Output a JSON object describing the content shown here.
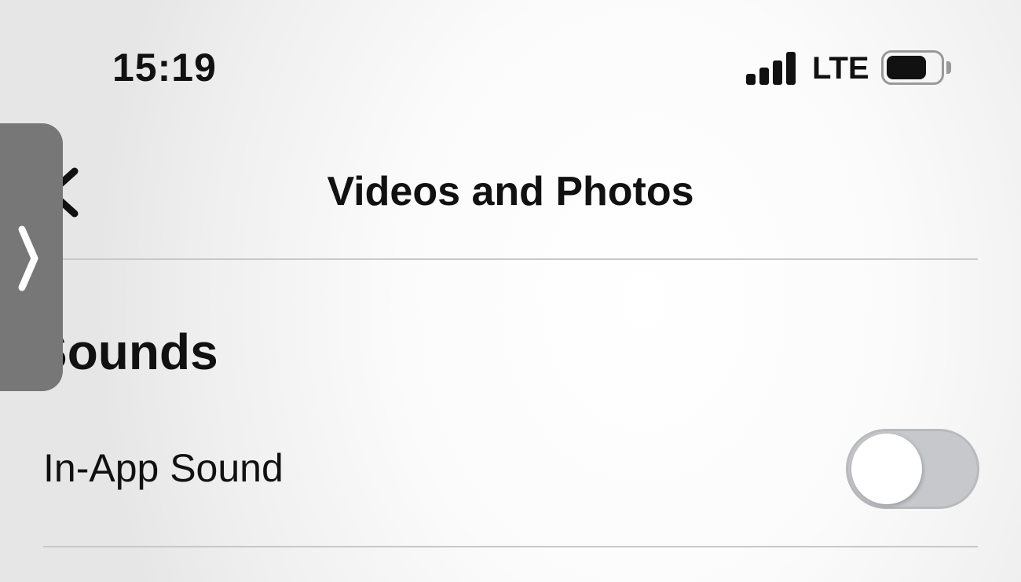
{
  "status_bar": {
    "time": "15:19",
    "network": "LTE",
    "signal_bars": 4,
    "battery_level": 0.75
  },
  "nav": {
    "title": "Videos and Photos",
    "back_icon": "chevron-left-icon"
  },
  "section": {
    "header": "Sounds",
    "rows": [
      {
        "label": "In-App Sound",
        "toggle_on": false
      }
    ]
  },
  "overlay": {
    "side_handle_icon": "chevron-right-icon"
  },
  "colors": {
    "toggle_off_track": "#c7c8cc",
    "toggle_knob": "#ffffff",
    "divider": "#c8c8c8",
    "side_handle": "#777777",
    "text": "#111111"
  }
}
